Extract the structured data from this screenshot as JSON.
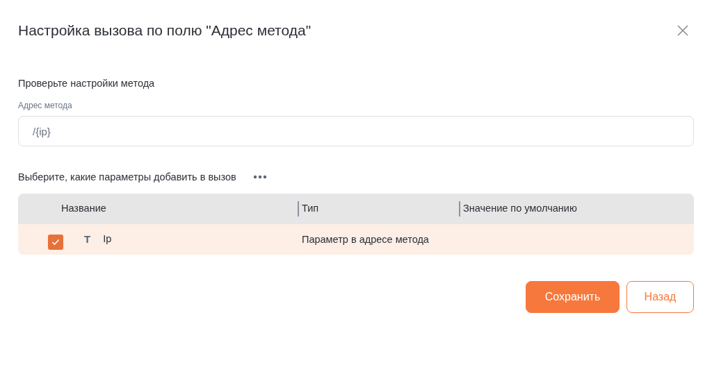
{
  "dialog": {
    "title": "Настройка вызова по полю \"Адрес метода\""
  },
  "section_heading": "Проверьте настройки метода",
  "address_field": {
    "label": "Адрес метода",
    "value": "/{ip}"
  },
  "params_heading": "Выберите, какие параметры добавить в вызов",
  "table": {
    "columns": [
      "Название",
      "Тип",
      "Значение по умолчанию"
    ],
    "rows": [
      {
        "checked": true,
        "type_glyph": "T",
        "name": "Ip",
        "type": "Параметр в адресе метода"
      }
    ]
  },
  "buttons": [
    {
      "kind": "primary",
      "label": "Сохранить"
    },
    {
      "kind": "secondary",
      "label": "Назад"
    }
  ]
}
